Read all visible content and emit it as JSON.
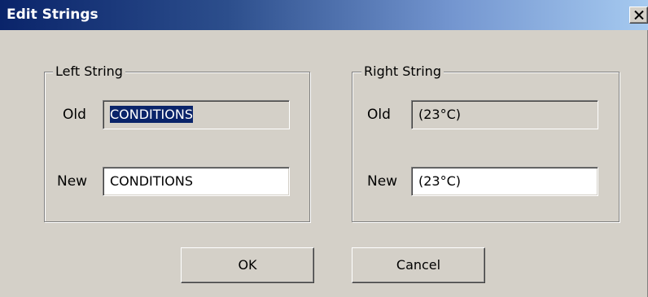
{
  "window": {
    "title": "Edit Strings"
  },
  "left_group": {
    "legend": "Left String",
    "old_label": "Old",
    "old_value": "CONDITIONS",
    "new_label": "New",
    "new_value": "CONDITIONS"
  },
  "right_group": {
    "legend": "Right String",
    "old_label": "Old",
    "old_value": "(23°C)",
    "new_label": "New",
    "new_value": "(23°C)"
  },
  "buttons": {
    "ok_label": "OK",
    "cancel_label": "Cancel"
  },
  "icons": {
    "close": "close-icon"
  },
  "colors": {
    "title_bar_start": "#0a246a",
    "title_bar_end": "#a6caf0",
    "dialog_face": "#d4d0c8",
    "selection": "#0a246a"
  }
}
